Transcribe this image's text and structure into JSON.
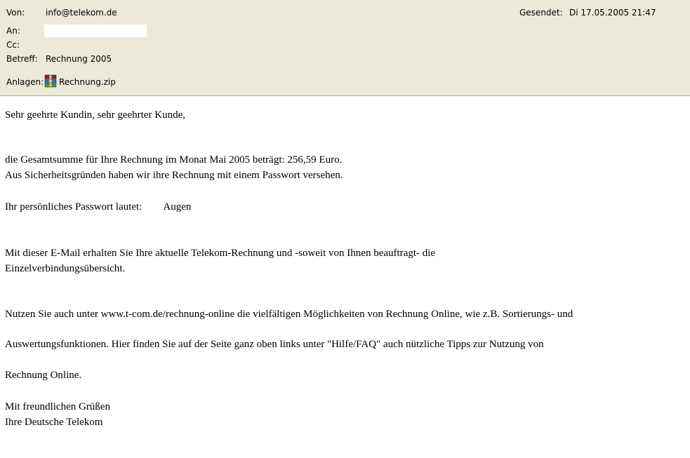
{
  "header": {
    "from_label": "Von:",
    "from_value": "info@telekom.de",
    "sent_label": "Gesendet:",
    "sent_value": "Di 17.05.2005 21:47",
    "to_label": "An:",
    "to_value": "",
    "cc_label": "Cc:",
    "cc_value": "",
    "subject_label": "Betreff:",
    "subject_value": "Rechnung 2005",
    "attachments_label": "Anlagen:",
    "attachment_name": "Rechnung.zip",
    "attachment_icon": "winrar-archive-icon"
  },
  "body": {
    "greeting": "Sehr geehrte Kundin, sehr geehrter Kunde,",
    "line1": "die Gesamtsumme für Ihre Rechnung im Monat Mai 2005 beträgt: 256,59 Euro.",
    "line2": "Aus Sicherheitsgründen haben wir ihre Rechnung mit einem Passwort versehen.",
    "password_label": "Ihr persönliches Passwort lautet:",
    "password_value": "Augen",
    "line3a": "Mit dieser E-Mail erhalten Sie Ihre aktuelle Telekom-Rechnung und -soweit von Ihnen beauftragt- die",
    "line3b": "Einzelverbindungsübersicht.",
    "line4a": "Nutzen Sie auch unter www.t-com.de/rechnung-online die vielfältigen Möglichkeiten von Rechnung Online, wie z.B. Sortierungs- und",
    "line4b": "Auswertungsfunktionen. Hier finden Sie auf der Seite ganz oben links unter \"Hilfe/FAQ\" auch nützliche Tipps zur Nutzung von",
    "line4c": "Rechnung Online.",
    "closing1": "Mit freundlichen Grüßen",
    "closing2": "Ihre Deutsche Telekom"
  },
  "colors": {
    "header_bg": "#ece9d8",
    "body_bg": "#ffffff"
  }
}
